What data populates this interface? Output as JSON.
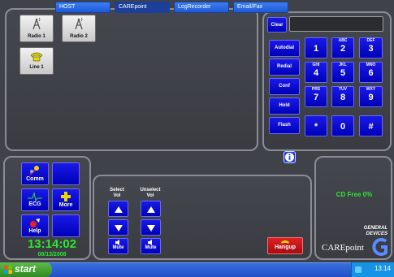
{
  "lines": [
    {
      "label": "Radio 1",
      "icon": "radio-tower-icon"
    },
    {
      "label": "Radio 2",
      "icon": "radio-tower-icon"
    },
    {
      "label": "Line 1",
      "icon": "telephone-icon"
    }
  ],
  "dialer": {
    "clear_label": "Clear",
    "display_value": "",
    "functions": [
      "Autodial",
      "Redial",
      "Conf",
      "Hold",
      "Flash"
    ],
    "keys": [
      {
        "main": "1",
        "sub": ""
      },
      {
        "main": "2",
        "sub": "ABC"
      },
      {
        "main": "3",
        "sub": "DEF"
      },
      {
        "main": "4",
        "sub": "GHI"
      },
      {
        "main": "5",
        "sub": "JKL"
      },
      {
        "main": "6",
        "sub": "MNO"
      },
      {
        "main": "7",
        "sub": "PRS"
      },
      {
        "main": "8",
        "sub": "TUV"
      },
      {
        "main": "9",
        "sub": "WXY"
      },
      {
        "main": "*",
        "sub": ""
      },
      {
        "main": "0",
        "sub": ""
      },
      {
        "main": "#",
        "sub": ""
      }
    ]
  },
  "nav": {
    "comm": "Comm",
    "ecg": "ECG",
    "more": "More",
    "help": "Help"
  },
  "clock": {
    "time": "13:14:02",
    "date": "08/13/2008"
  },
  "volume": {
    "select_label": "Select\nVol",
    "select_line1": "Select",
    "select_line2": "Vol",
    "unselect_line1": "Unselect",
    "unselect_line2": "Vol",
    "mute_label": "Mute"
  },
  "hangup_label": "Hangup",
  "status": {
    "cd_free": "CD Free 0%"
  },
  "brand": {
    "line1": "GENERAL",
    "line2": "DEVICES",
    "product": "CAREpoint"
  },
  "taskbar": {
    "start": "start",
    "items": [
      "HOST",
      "CAREpoint",
      "LogRecorder",
      "Email/Fax"
    ],
    "tray_time": "13:14"
  },
  "colors": {
    "accent_blue": "#0000d0",
    "clock_green": "#2ee62e",
    "hangup_red": "#c0141a"
  }
}
